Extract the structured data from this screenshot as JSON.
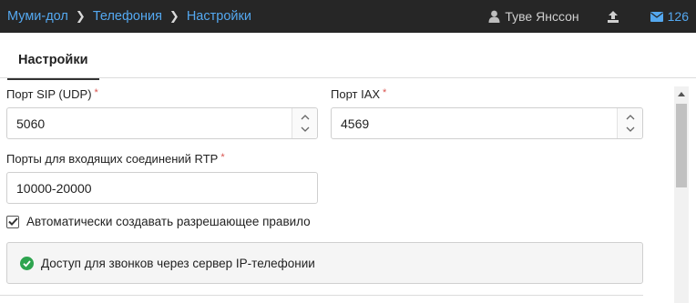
{
  "breadcrumb": {
    "items": [
      "Муми-дол",
      "Телефония",
      "Настройки"
    ]
  },
  "header": {
    "user_name": "Туве Янссон",
    "mail_count": "126"
  },
  "tabs": {
    "active_label": "Настройки"
  },
  "form": {
    "sip_port": {
      "label": "Порт SIP (UDP)",
      "required_mark": "*",
      "value": "5060"
    },
    "iax_port": {
      "label": "Порт IAX",
      "required_mark": "*",
      "value": "4569"
    },
    "rtp_ports": {
      "label": "Порты для входящих соединений RTP",
      "required_mark": "*",
      "value": "10000-20000"
    },
    "auto_rule": {
      "label": "Автоматически создавать разрешающее правило",
      "checked": true
    },
    "info_message": "Доступ для звонков через сервер IP-телефонии"
  },
  "colors": {
    "topbar_bg": "#262626",
    "link_blue": "#54a8f0",
    "required_red": "#d9534f",
    "success_green": "#2ea44f"
  }
}
